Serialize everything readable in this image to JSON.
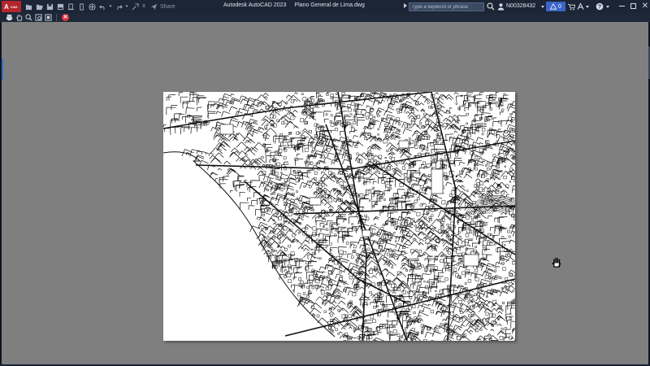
{
  "titlebar": {
    "app_badge": "A",
    "app_badge_sub": "CAD",
    "app_title": "Autodesk AutoCAD 2023",
    "document_name": "Plano General de Lima.dwg",
    "share_label": "Share",
    "search_placeholder": "Type a keyword or phrase",
    "username": "N00328432",
    "alert_count": "0",
    "close_glyph": "✕"
  },
  "quick_access": [
    "new-icon",
    "open-icon",
    "save-icon",
    "save-as-icon",
    "open-from-web-icon",
    "save-to-web-icon",
    "plot-icon",
    "undo-icon",
    "redo-icon",
    "match-properties-icon",
    "customize-icon"
  ],
  "preview_toolbar": {
    "tools": [
      "print-icon",
      "pan-icon",
      "zoom-icon",
      "zoom-window-icon",
      "zoom-original-icon"
    ],
    "close_glyph": "✕"
  },
  "colors": {
    "titlebar_bg": "#1c2535",
    "toolbar_bg": "#1f2838",
    "canvas_bg": "#7f7f7f",
    "sheet_bg": "#ffffff",
    "app_badge": "#b3262b",
    "alert_badge": "#3d63c9",
    "close_preview": "#e0323c"
  },
  "cursor": "pan-hand-icon"
}
